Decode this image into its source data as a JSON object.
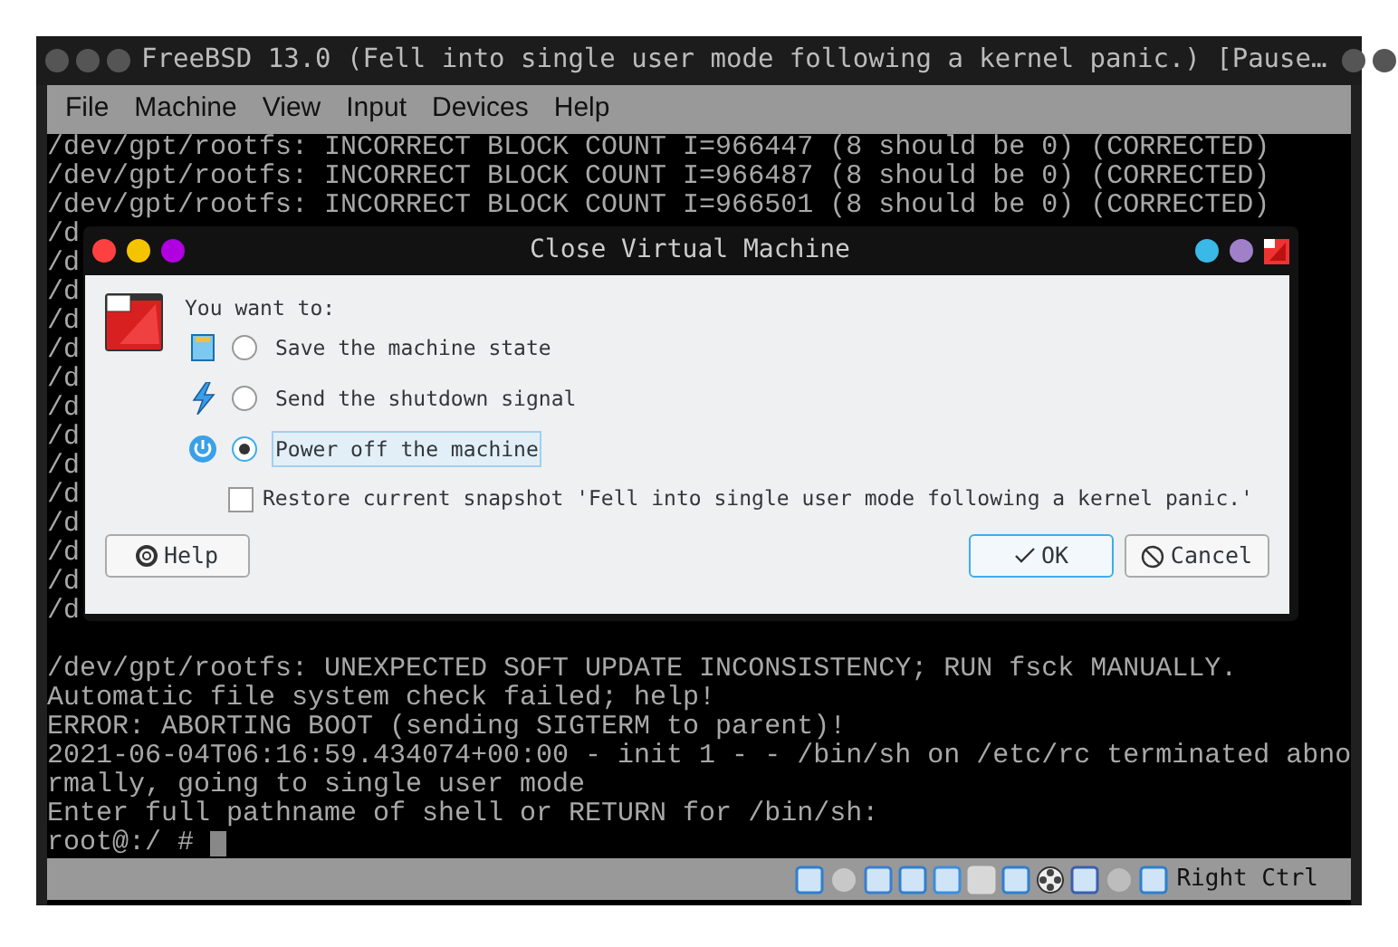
{
  "window": {
    "title": "FreeBSD 13.0 (Fell into single user mode following a kernel panic.) [Pause…"
  },
  "menu": [
    "File",
    "Machine",
    "View",
    "Input",
    "Devices",
    "Help"
  ],
  "console": {
    "lines_top": [
      "/dev/gpt/rootfs: INCORRECT BLOCK COUNT I=966447 (8 should be 0) (CORRECTED)",
      "/dev/gpt/rootfs: INCORRECT BLOCK COUNT I=966487 (8 should be 0) (CORRECTED)",
      "/dev/gpt/rootfs: INCORRECT BLOCK COUNT I=966501 (8 should be 0) (CORRECTED)",
      "/d",
      "/d",
      "/d",
      "/d",
      "/d",
      "/d",
      "/d",
      "/d",
      "/d",
      "/d",
      "/d",
      "/d",
      "/d",
      "/d"
    ],
    "lines_bottom": [
      "/dev/gpt/rootfs: UNEXPECTED SOFT UPDATE INCONSISTENCY; RUN fsck MANUALLY.",
      "Automatic file system check failed; help!",
      "ERROR: ABORTING BOOT (sending SIGTERM to parent)!",
      "2021-06-04T06:16:59.434074+00:00 - init 1 - - /bin/sh on /etc/rc terminated abno",
      "rmally, going to single user mode",
      "Enter full pathname of shell or RETURN for /bin/sh:"
    ],
    "prompt": "root@:/ #"
  },
  "dialog": {
    "title": "Close Virtual Machine",
    "prompt": "You want to:",
    "options": [
      {
        "kind": "save",
        "label": "Save the machine state",
        "selected": false
      },
      {
        "kind": "shutdown",
        "label": "Send the shutdown signal",
        "selected": false
      },
      {
        "kind": "power",
        "label": "Power off the machine",
        "selected": true
      }
    ],
    "restore": {
      "label": "Restore current snapshot 'Fell into single user mode following a kernel panic.'",
      "checked": false
    },
    "buttons": [
      {
        "kind": "help",
        "label": "Help"
      },
      {
        "kind": "ok",
        "label": "OK"
      },
      {
        "kind": "cancel",
        "label": "Cancel"
      }
    ]
  },
  "status_bar": {
    "host_key": "Right Ctrl"
  }
}
